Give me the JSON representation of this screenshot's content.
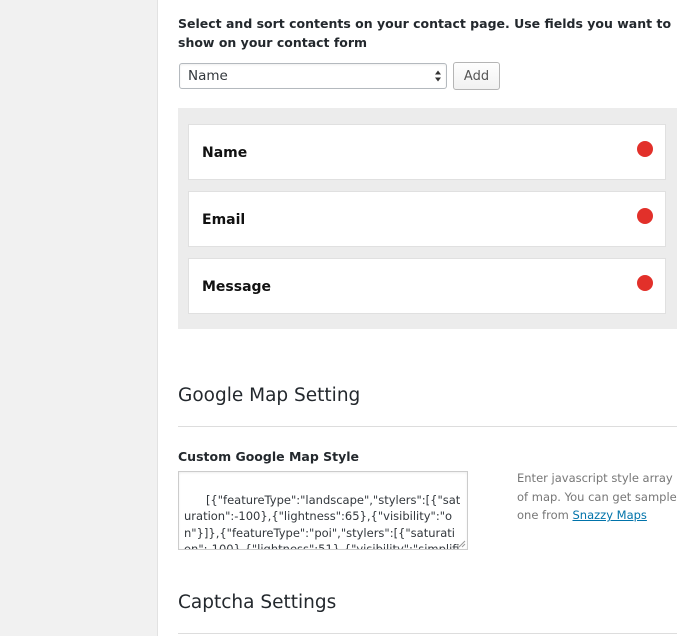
{
  "contact_form": {
    "intro_text": "Select and sort contents on your contact page. Use fields you want to show on your contact form",
    "field_select": {
      "selected_value": "Name"
    },
    "add_button_label": "Add",
    "fields": [
      {
        "label": "Name"
      },
      {
        "label": "Email"
      },
      {
        "label": "Message"
      }
    ],
    "remove_color": "#e2302a"
  },
  "google_map": {
    "section_title": "Google Map Setting",
    "style_field_label": "Custom Google Map Style",
    "style_value": "[{\"featureType\":\"landscape\",\"stylers\":[{\"saturation\":-100},{\"lightness\":65},{\"visibility\":\"on\"}]},{\"featureType\":\"poi\",\"stylers\":[{\"saturation\":-100},{\"lightness\":51},{\"visibility\":\"simplified\"}]}",
    "help_text_before_link": "Enter javascript style array of map. You can get sample one from ",
    "help_link_text": "Snazzy Maps"
  },
  "captcha": {
    "section_title": "Captcha Settings"
  },
  "colors": {
    "link": "#0073aa",
    "panel_background": "#ececec"
  }
}
